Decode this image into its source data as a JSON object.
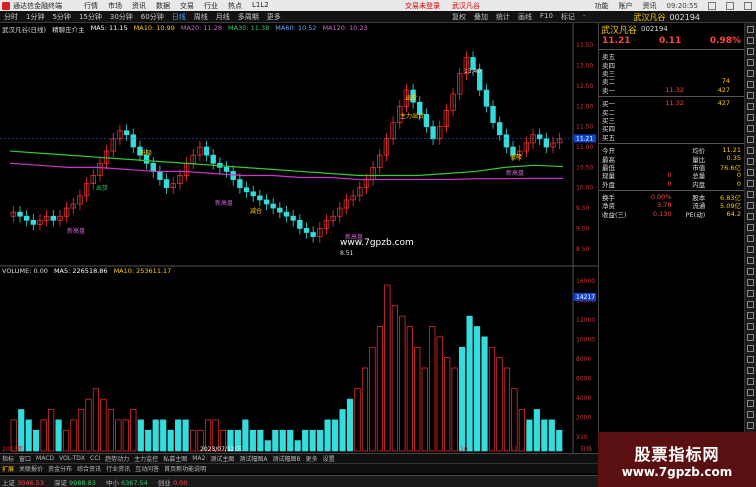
{
  "titlebar": {
    "app_name": "通达信金融终端",
    "menu": [
      "行情",
      "市场",
      "资讯",
      "数据",
      "交易",
      "行业",
      "热点",
      "L1L2"
    ],
    "notice": [
      "交易未登录",
      "武汉凡谷"
    ],
    "right": [
      "功能",
      "账户",
      "资讯"
    ],
    "clock": "09:20:55"
  },
  "toolbar": {
    "periods": [
      "分时",
      "1分钟",
      "5分钟",
      "15分钟",
      "30分钟",
      "60分钟",
      "日线",
      "周线",
      "月线",
      "多周期",
      "更多"
    ],
    "active_period": "日线",
    "tools": [
      "复权",
      "叠加",
      "统计",
      "画线",
      "F10",
      "标记",
      "-"
    ],
    "stock_name": "武汉凡谷",
    "stock_code": "002194"
  },
  "chart": {
    "legend_main": [
      "武汉凡谷(日线)",
      "精聊庄介主",
      "MA5: 11.15",
      "MA10: 10.99",
      "MA20: 11.28",
      "MA30: 11.38",
      "MA60: 10.52",
      "MA120: 10.23"
    ],
    "legend_vol": [
      "VOLUME: 0.00",
      "MA5: 226518.86",
      "MA10: 253611.17"
    ],
    "y_labels_main": [
      "13.50",
      "13.00",
      "12.50",
      "12.00",
      "11.50",
      "11.00",
      "10.50",
      "10.00",
      "9.50",
      "9.00",
      "8.50"
    ],
    "y_labels_vol": [
      "16000",
      "14000",
      "12000",
      "10000",
      "8000",
      "6000",
      "4000",
      "2000",
      "X10"
    ],
    "annotations": [
      {
        "text": "13.49",
        "color": "#dddddd"
      },
      {
        "text": "8.51",
        "color": "#dddddd"
      },
      {
        "text": "出货",
        "color": "#ffcc00"
      },
      {
        "text": "主力出货",
        "color": "#ffcc00"
      },
      {
        "text": "出货",
        "color": "#33cc66"
      },
      {
        "text": "低吸",
        "color": "#ffcc00"
      },
      {
        "text": "减仓",
        "color": "#ffcc00"
      },
      {
        "text": "低吸",
        "color": "#ffcc00"
      },
      {
        "text": "新高盘",
        "color": "#cc66cc"
      },
      {
        "text": "新高盘",
        "color": "#cc66cc"
      },
      {
        "text": "新高盘",
        "color": "#cc66cc"
      },
      {
        "text": "新高盘",
        "color": "#cc66cc"
      }
    ],
    "watermark": "www.7gpzb.com",
    "current_price_tag": "11.21",
    "vol_tag": "14217",
    "x_labels": [
      "2023年",
      "2023/07/12/三",
      "10",
      "11",
      "日线"
    ]
  },
  "chart_data": {
    "type": "line",
    "title": "",
    "xlabel": "",
    "ylabel": "",
    "ylim": [
      8.2,
      13.8
    ],
    "candles_close": [
      9.4,
      9.3,
      9.2,
      9.1,
      9.2,
      9.3,
      9.2,
      9.3,
      9.5,
      9.6,
      9.8,
      10.1,
      10.3,
      10.6,
      10.9,
      11.2,
      11.4,
      11.3,
      11.0,
      10.8,
      10.6,
      10.4,
      10.2,
      10.0,
      10.1,
      10.3,
      10.6,
      10.8,
      11.0,
      10.8,
      10.6,
      10.5,
      10.4,
      10.2,
      10.0,
      9.9,
      9.8,
      9.7,
      9.6,
      9.5,
      9.4,
      9.3,
      9.2,
      9.0,
      8.9,
      8.8,
      9.0,
      9.2,
      9.3,
      9.5,
      9.7,
      9.8,
      10.0,
      10.2,
      10.5,
      10.8,
      11.2,
      11.6,
      12.0,
      12.4,
      12.1,
      11.8,
      11.5,
      11.2,
      11.5,
      11.9,
      12.3,
      12.8,
      13.2,
      12.9,
      12.4,
      12.0,
      11.6,
      11.3,
      11.0,
      10.8,
      10.9,
      11.1,
      11.3,
      11.2,
      11.0,
      11.1,
      11.2
    ],
    "series": [
      {
        "name": "MA60",
        "values": [
          10.9,
          10.85,
          10.8,
          10.75,
          10.7,
          10.65,
          10.6,
          10.55,
          10.5,
          10.45,
          10.4,
          10.35,
          10.3,
          10.3,
          10.3,
          10.35,
          10.4,
          10.5,
          10.55,
          10.52
        ]
      },
      {
        "name": "MA120",
        "values": [
          10.6,
          10.55,
          10.5,
          10.5,
          10.45,
          10.4,
          10.4,
          10.35,
          10.3,
          10.3,
          10.25,
          10.25,
          10.2,
          10.2,
          10.2,
          10.2,
          10.22,
          10.22,
          10.23,
          10.23
        ]
      }
    ],
    "volumes": [
      3,
      4,
      3,
      2,
      3,
      4,
      3,
      2,
      3,
      4,
      5,
      6,
      5,
      4,
      3,
      3,
      4,
      3,
      2,
      3,
      3,
      2,
      3,
      3,
      2,
      2,
      3,
      3,
      2,
      2,
      2,
      3,
      2,
      2,
      1,
      2,
      2,
      2,
      1,
      2,
      2,
      2,
      3,
      3,
      4,
      5,
      6,
      8,
      10,
      12,
      16,
      14,
      13,
      12,
      10,
      8,
      12,
      11,
      9,
      8,
      10,
      13,
      12,
      11,
      10,
      9,
      8,
      6,
      4,
      3,
      4,
      3,
      3,
      2
    ]
  },
  "quote": {
    "stock_name": "武汉凡谷",
    "code": "002194",
    "last": "11.21",
    "change": "0.11",
    "change_pct": "0.98%",
    "asks": [
      {
        "label": "卖五",
        "price": "",
        "vol": ""
      },
      {
        "label": "卖四",
        "price": "",
        "vol": ""
      },
      {
        "label": "卖三",
        "price": "",
        "vol": ""
      },
      {
        "label": "卖二",
        "price": "",
        "vol": "74"
      },
      {
        "label": "卖一",
        "price": "11.32",
        "vol": "427"
      }
    ],
    "bids": [
      {
        "label": "买一",
        "price": "11.32",
        "vol": "427"
      },
      {
        "label": "买二",
        "price": "",
        "vol": ""
      },
      {
        "label": "买三",
        "price": "",
        "vol": ""
      },
      {
        "label": "买四",
        "price": "",
        "vol": ""
      },
      {
        "label": "买五",
        "price": "",
        "vol": ""
      }
    ],
    "stats": [
      {
        "a": "今开",
        "b": "",
        "c": "均价",
        "d": "11.21"
      },
      {
        "a": "最高",
        "b": "",
        "c": "量比",
        "d": "0.35"
      },
      {
        "a": "最低",
        "b": "",
        "c": "市值",
        "d": "76.6亿"
      },
      {
        "a": "现量",
        "b": "0",
        "c": "总量",
        "d": "0"
      },
      {
        "a": "外盘",
        "b": "0",
        "c": "内盘",
        "d": "0"
      }
    ],
    "stats2": [
      {
        "a": "换手",
        "b": "0.00%",
        "c": "股本",
        "d": "6.83亿"
      },
      {
        "a": "净资",
        "b": "3.78",
        "c": "流通",
        "d": "5.09亿"
      },
      {
        "a": "收益(三)",
        "b": "0.130",
        "c": "PE(动)",
        "d": "64.2"
      }
    ]
  },
  "tabs": [
    "指标",
    "窗口",
    "MACD",
    "VOL-TDX",
    "CCI",
    "趋势动力",
    "主力监控",
    "私募主图",
    "MA2",
    "测试主图",
    "测试幅图A",
    "测试幅图B",
    "更多",
    "设置"
  ],
  "tabs2": [
    "扩展",
    "关联报价",
    "资金分布",
    "综合资讯",
    "行业资讯",
    "互动问答",
    "首页新功能说明"
  ],
  "status": [
    {
      "label": "上证",
      "value": "3046.53",
      "cls": "up"
    },
    {
      "label": "深证",
      "value": "9988.83",
      "cls": "down"
    },
    {
      "label": "中小",
      "value": "6367.54",
      "cls": "down"
    },
    {
      "label": "创业",
      "value": "0.00",
      "cls": "up"
    }
  ],
  "promo": {
    "line1": "股票指标网",
    "line2": "www.7gpzb.com"
  }
}
